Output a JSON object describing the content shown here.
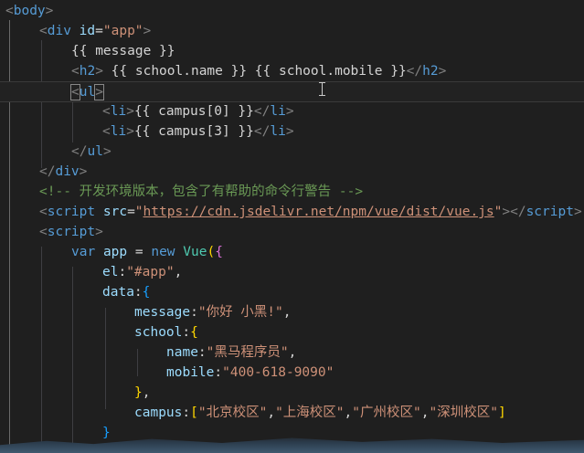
{
  "editor": {
    "lines": [
      [
        [
          "t-punc",
          "<"
        ],
        [
          "t-tag",
          "body"
        ],
        [
          "t-punc",
          ">"
        ]
      ],
      [
        [
          "t-punc",
          "<"
        ],
        [
          "t-tag",
          "div"
        ],
        [
          "t-text",
          " "
        ],
        [
          "t-attr",
          "id"
        ],
        [
          "t-text",
          "="
        ],
        [
          "t-str",
          "\"app\""
        ],
        [
          "t-punc",
          ">"
        ]
      ],
      [
        [
          "t-text",
          "{{ message }}"
        ]
      ],
      [
        [
          "t-punc",
          "<"
        ],
        [
          "t-tag",
          "h2"
        ],
        [
          "t-punc",
          ">"
        ],
        [
          "t-text",
          " {{ school.name }} {{ school.mobile }}"
        ],
        [
          "t-punc",
          "</"
        ],
        [
          "t-tag",
          "h2"
        ],
        [
          "t-punc",
          ">"
        ]
      ],
      [
        [
          "t-punc",
          "<"
        ],
        [
          "t-tag",
          "ul"
        ],
        [
          "t-punc",
          ">"
        ]
      ],
      [
        [
          "t-punc",
          "<"
        ],
        [
          "t-tag",
          "li"
        ],
        [
          "t-punc",
          ">"
        ],
        [
          "t-text",
          "{{ campus[0] }}"
        ],
        [
          "t-punc",
          "</"
        ],
        [
          "t-tag",
          "li"
        ],
        [
          "t-punc",
          ">"
        ]
      ],
      [
        [
          "t-punc",
          "<"
        ],
        [
          "t-tag",
          "li"
        ],
        [
          "t-punc",
          ">"
        ],
        [
          "t-text",
          "{{ campus[3] }}"
        ],
        [
          "t-punc",
          "</"
        ],
        [
          "t-tag",
          "li"
        ],
        [
          "t-punc",
          ">"
        ]
      ],
      [
        [
          "t-punc",
          "</"
        ],
        [
          "t-tag",
          "ul"
        ],
        [
          "t-punc",
          ">"
        ]
      ],
      [
        [
          "t-punc",
          "</"
        ],
        [
          "t-tag",
          "div"
        ],
        [
          "t-punc",
          ">"
        ]
      ],
      [
        [
          "t-comment",
          "<!-- 开发环境版本，包含了有帮助的命令行警告 -->"
        ]
      ],
      [
        [
          "t-punc",
          "<"
        ],
        [
          "t-tag",
          "script"
        ],
        [
          "t-text",
          " "
        ],
        [
          "t-attr",
          "src"
        ],
        [
          "t-text",
          "="
        ],
        [
          "t-str",
          "\""
        ],
        [
          "t-url",
          "https://cdn.jsdelivr.net/npm/vue/dist/vue.js"
        ],
        [
          "t-str",
          "\""
        ],
        [
          "t-punc",
          "></"
        ],
        [
          "t-tag",
          "script"
        ],
        [
          "t-punc",
          ">"
        ]
      ],
      [
        [
          "t-punc",
          "<"
        ],
        [
          "t-tag",
          "script"
        ],
        [
          "t-punc",
          ">"
        ]
      ],
      [
        [
          "t-kw",
          "var"
        ],
        [
          "t-text",
          " "
        ],
        [
          "t-var",
          "app"
        ],
        [
          "t-text",
          " = "
        ],
        [
          "t-kw",
          "new"
        ],
        [
          "t-text",
          " "
        ],
        [
          "t-cls",
          "Vue"
        ],
        [
          "t-brace",
          "("
        ],
        [
          "t-brace2",
          "{"
        ]
      ],
      [
        [
          "t-prop",
          "el"
        ],
        [
          "t-text",
          ":"
        ],
        [
          "t-str",
          "\"#app\""
        ],
        [
          "t-text",
          ","
        ]
      ],
      [
        [
          "t-prop",
          "data"
        ],
        [
          "t-text",
          ":"
        ],
        [
          "t-brace3",
          "{"
        ]
      ],
      [
        [
          "t-prop",
          "message"
        ],
        [
          "t-text",
          ":"
        ],
        [
          "t-str",
          "\"你好 小黑!\""
        ],
        [
          "t-text",
          ","
        ]
      ],
      [
        [
          "t-prop",
          "school"
        ],
        [
          "t-text",
          ":"
        ],
        [
          "t-brace",
          "{"
        ]
      ],
      [
        [
          "t-prop",
          "name"
        ],
        [
          "t-text",
          ":"
        ],
        [
          "t-str",
          "\"黑马程序员\""
        ],
        [
          "t-text",
          ","
        ]
      ],
      [
        [
          "t-prop",
          "mobile"
        ],
        [
          "t-text",
          ":"
        ],
        [
          "t-str",
          "\"400-618-9090\""
        ]
      ],
      [
        [
          "t-brace",
          "}"
        ],
        [
          "t-text",
          ","
        ]
      ],
      [
        [
          "t-prop",
          "campus"
        ],
        [
          "t-text",
          ":"
        ],
        [
          "t-brace",
          "["
        ],
        [
          "t-str",
          "\"北京校区\""
        ],
        [
          "t-text",
          ","
        ],
        [
          "t-str",
          "\"上海校区\""
        ],
        [
          "t-text",
          ","
        ],
        [
          "t-str",
          "\"广州校区\""
        ],
        [
          "t-text",
          ","
        ],
        [
          "t-str",
          "\"深圳校区\""
        ],
        [
          "t-brace",
          "]"
        ]
      ],
      [
        [
          "t-brace3",
          "}"
        ]
      ],
      [
        [
          "t-brace2",
          "}"
        ],
        [
          "t-brace",
          ")"
        ]
      ]
    ]
  }
}
